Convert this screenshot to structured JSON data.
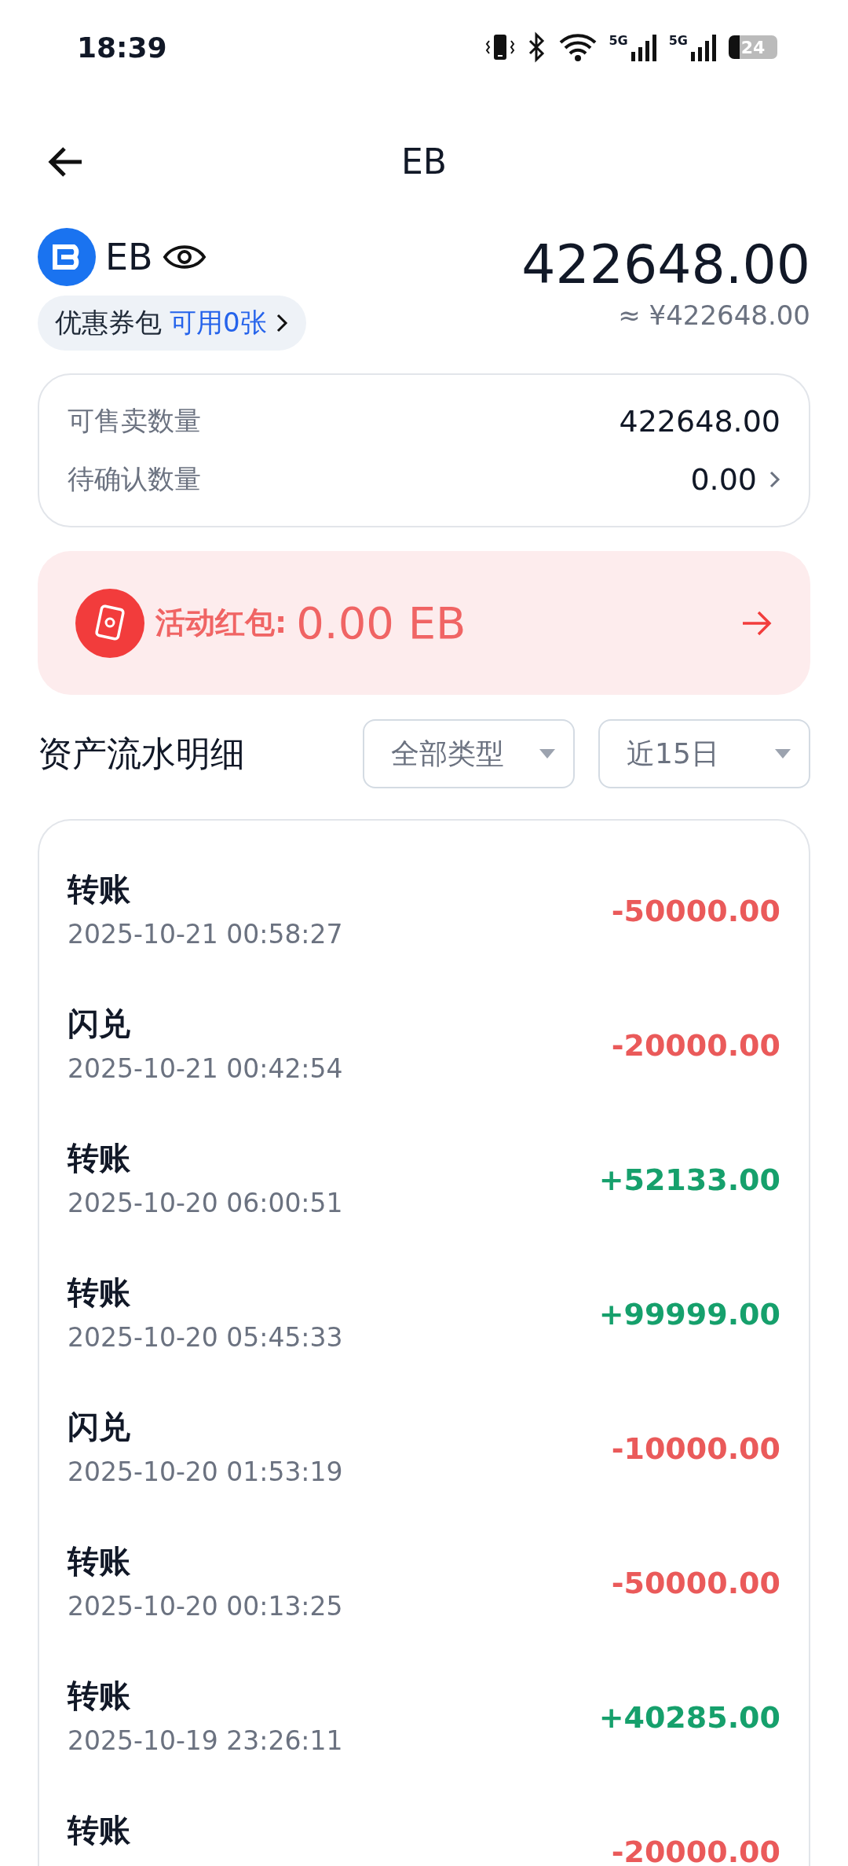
{
  "status_bar": {
    "time": "18:39",
    "network_labels": [
      "5G",
      "5G"
    ],
    "battery": "24"
  },
  "header": {
    "title": "EB"
  },
  "asset": {
    "symbol": "EB",
    "balance": "422648.00",
    "fiat": "≈ ¥422648.00",
    "coupon_label": "优惠券包",
    "coupon_available": "可用0张"
  },
  "quantities": [
    {
      "label": "可售卖数量",
      "value": "422648.00",
      "has_arrow": false
    },
    {
      "label": "待确认数量",
      "value": "0.00",
      "has_arrow": true
    }
  ],
  "red_packet": {
    "label": "活动红包:",
    "amount": "0.00 EB"
  },
  "history": {
    "title": "资产流水明细",
    "filters": [
      "全部类型",
      "近15日"
    ],
    "rows": [
      {
        "type": "转账",
        "time": "2025-10-21 00:58:27",
        "amount": "-50000.00",
        "kind": "out"
      },
      {
        "type": "闪兑",
        "time": "2025-10-21 00:42:54",
        "amount": "-20000.00",
        "kind": "out"
      },
      {
        "type": "转账",
        "time": "2025-10-20 06:00:51",
        "amount": "+52133.00",
        "kind": "in"
      },
      {
        "type": "转账",
        "time": "2025-10-20 05:45:33",
        "amount": "+99999.00",
        "kind": "in"
      },
      {
        "type": "闪兑",
        "time": "2025-10-20 01:53:19",
        "amount": "-10000.00",
        "kind": "out"
      },
      {
        "type": "转账",
        "time": "2025-10-20 00:13:25",
        "amount": "-50000.00",
        "kind": "out"
      },
      {
        "type": "转账",
        "time": "2025-10-19 23:26:11",
        "amount": "+40285.00",
        "kind": "in"
      },
      {
        "type": "转账",
        "amount": "-20000.00",
        "kind": "out"
      }
    ]
  }
}
